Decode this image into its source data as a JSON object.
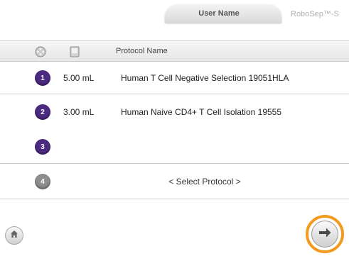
{
  "topbar": {
    "user_tab_label": "User Name",
    "brand": "RoboSep™-S"
  },
  "header": {
    "col1_icon": "carousel-icon",
    "col2_icon": "reagent-vial-icon",
    "protocol_label": "Protocol Name"
  },
  "quadrants": [
    {
      "number": "1",
      "volume": "5.00 mL",
      "protocol": "Human T Cell Negative Selection 19051HLA",
      "state": "assigned"
    },
    {
      "number": "2",
      "volume": "3.00 mL",
      "protocol": "Human Naive CD4+ T Cell Isolation 19555",
      "state": "assigned"
    },
    {
      "number": "3",
      "volume": "",
      "protocol": "",
      "state": "occupied-by-previous"
    },
    {
      "number": "4",
      "volume": "",
      "protocol": "< Select Protocol >",
      "state": "available"
    }
  ],
  "footer": {
    "home_icon": "home-icon",
    "next_icon": "arrow-right-icon"
  },
  "colors": {
    "quadrant_active": "#4b2a82",
    "quadrant_inactive": "#8e8e8e",
    "highlight_ring": "#f39a1e"
  }
}
